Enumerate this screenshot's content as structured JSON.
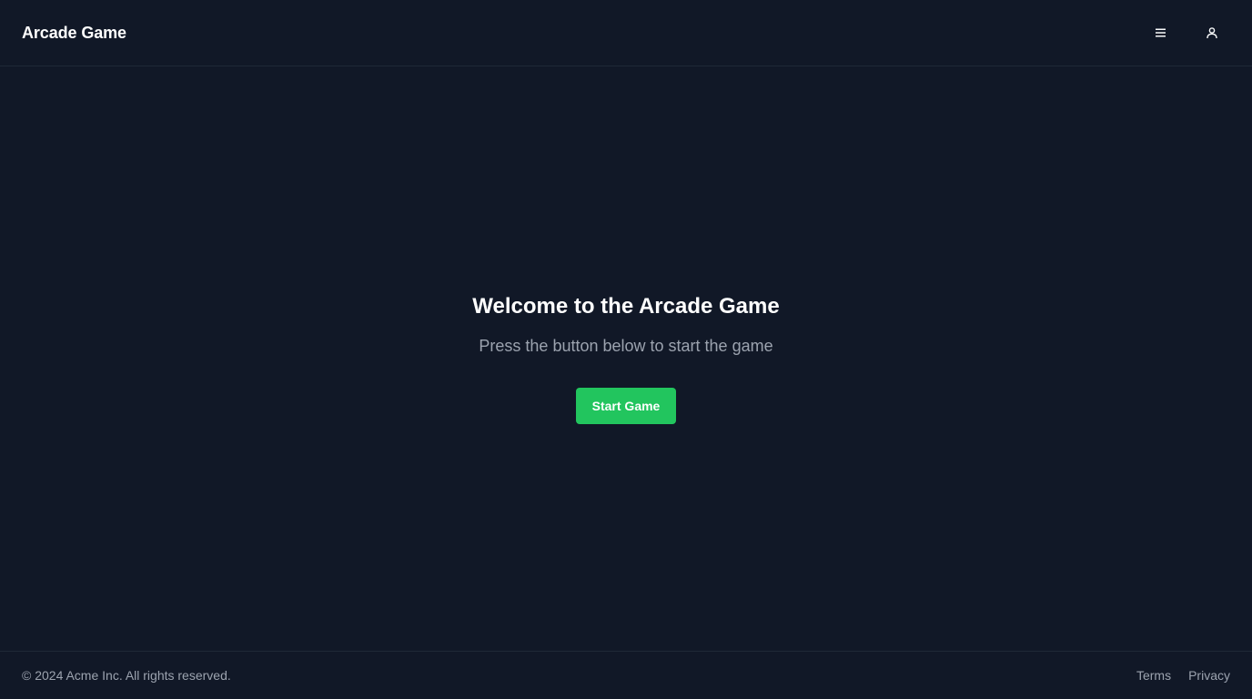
{
  "header": {
    "brand": "Arcade Game",
    "menu_icon": "menu-icon",
    "user_icon": "user-icon"
  },
  "hero": {
    "title": "Welcome to the Arcade Game",
    "subtitle": "Press the button below to start the game",
    "start_button_label": "Start Game"
  },
  "footer": {
    "copyright": "© 2024 Acme Inc. All rights reserved.",
    "links": [
      {
        "label": "Terms"
      },
      {
        "label": "Privacy"
      }
    ]
  },
  "colors": {
    "background": "#111827",
    "accent": "#22c55e",
    "muted_text": "#9ca3af",
    "border": "#1f2937"
  }
}
